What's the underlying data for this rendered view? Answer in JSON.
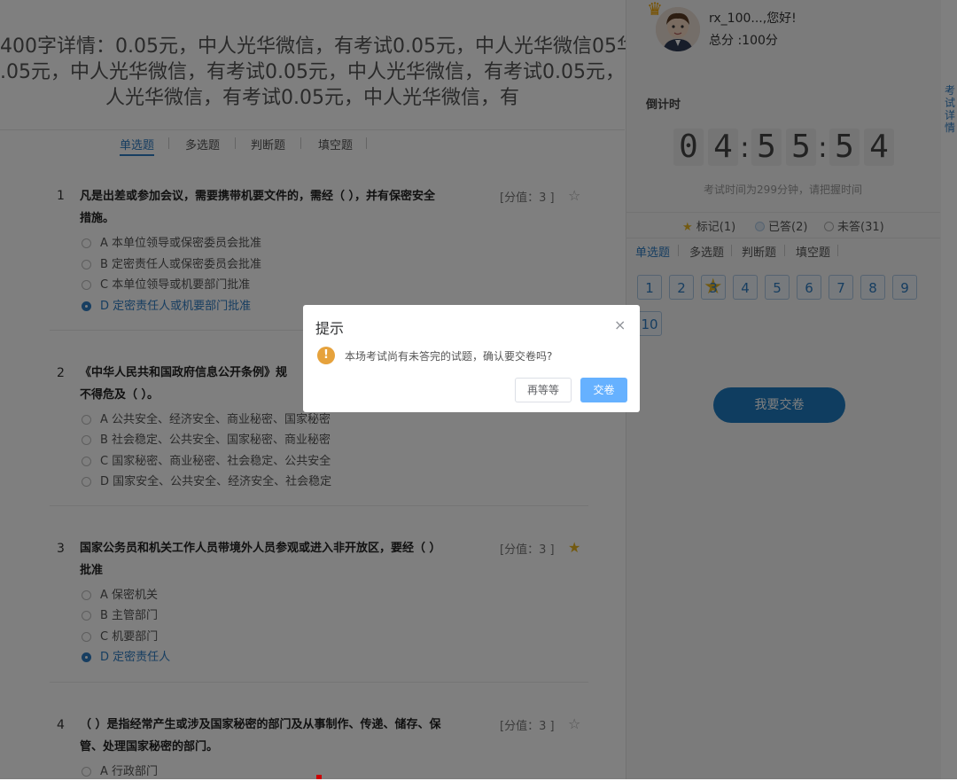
{
  "exam_title_lines": [
    "400字详情：0.05元，中人光华微信，有考试0.05元，中人光华微信05华",
    ".05元，中人光华微信，有考试0.05元，中人光华微信，有考试0.05元，中",
    "人光华微信，有考试0.05元，中人光华微信，有"
  ],
  "tabs": [
    "单选题",
    "多选题",
    "判断题",
    "填空题"
  ],
  "questions": [
    {
      "no": "1",
      "text_lines": [
        "凡是出差或参加会议，需要携带机要文件的，需经（   ），并有保密安全",
        "措施。"
      ],
      "score": "[分值：3 ]",
      "marked": false,
      "options": [
        "A 本单位领导或保密委员会批准",
        "B 定密责任人或保密委员会批准",
        "C 本单位领导或机要部门批准",
        "D 定密责任人或机要部门批准"
      ],
      "selected": 3
    },
    {
      "no": "2",
      "text_lines": [
        "《中华人民共和国政府信息公开条例》规",
        "不得危及（   ）。"
      ],
      "score": "",
      "marked": false,
      "options": [
        "A 公共安全、经济安全、商业秘密、国家秘密",
        "B 社会稳定、公共安全、国家秘密、商业秘密",
        "C 国家秘密、商业秘密、社会稳定、公共安全",
        "D 国家安全、公共安全、经济安全、社会稳定"
      ],
      "selected": -1
    },
    {
      "no": "3",
      "text_lines": [
        "国家公务员和机关工作人员带境外人员参观或进入非开放区，要经（   ）",
        "批准"
      ],
      "score": "[分值：3 ]",
      "marked": true,
      "options": [
        "A 保密机关",
        "B 主管部门",
        "C 机要部门",
        "D 定密责任人"
      ],
      "selected": 3
    },
    {
      "no": "4",
      "text_lines": [
        "（   ）是指经常产生或涉及国家秘密的部门及从事制作、传递、储存、保",
        "管、处理国家秘密的部门。"
      ],
      "score": "[分值：3 ]",
      "marked": false,
      "options": [
        "A 行政部门"
      ],
      "selected": -1
    }
  ],
  "user": {
    "greeting": "rx_100...,您好!",
    "score": "总分 :100分"
  },
  "countdown": {
    "label": "倒计时",
    "digits": [
      "0",
      "4",
      "5",
      "5",
      "5",
      "4"
    ],
    "note": "考试时间为299分钟，请把握时间"
  },
  "legend": {
    "marked": "标记(1)",
    "answered": "已答(2)",
    "unanswered": "未答(31)"
  },
  "right_tabs": [
    "单选题",
    "多选题",
    "判断题",
    "填空题"
  ],
  "question_numbers": [
    "1",
    "2",
    "3",
    "4",
    "5",
    "6",
    "7",
    "8",
    "9",
    "10"
  ],
  "marked_number": "3",
  "submit_label": "我要交卷",
  "side_tab_label": "考试详情",
  "dialog": {
    "title": "提示",
    "close": "×",
    "icon": "!",
    "message": "本场考试尚有未答完的试题，确认要交卷吗?",
    "cancel_label": "再等等",
    "confirm_label": "交卷"
  },
  "colors": {
    "accent": "#2f7cc2",
    "submit": "#1e7bc0",
    "star": "#e6b422",
    "warning": "#e6a23c",
    "confirm": "#66b1ff"
  }
}
